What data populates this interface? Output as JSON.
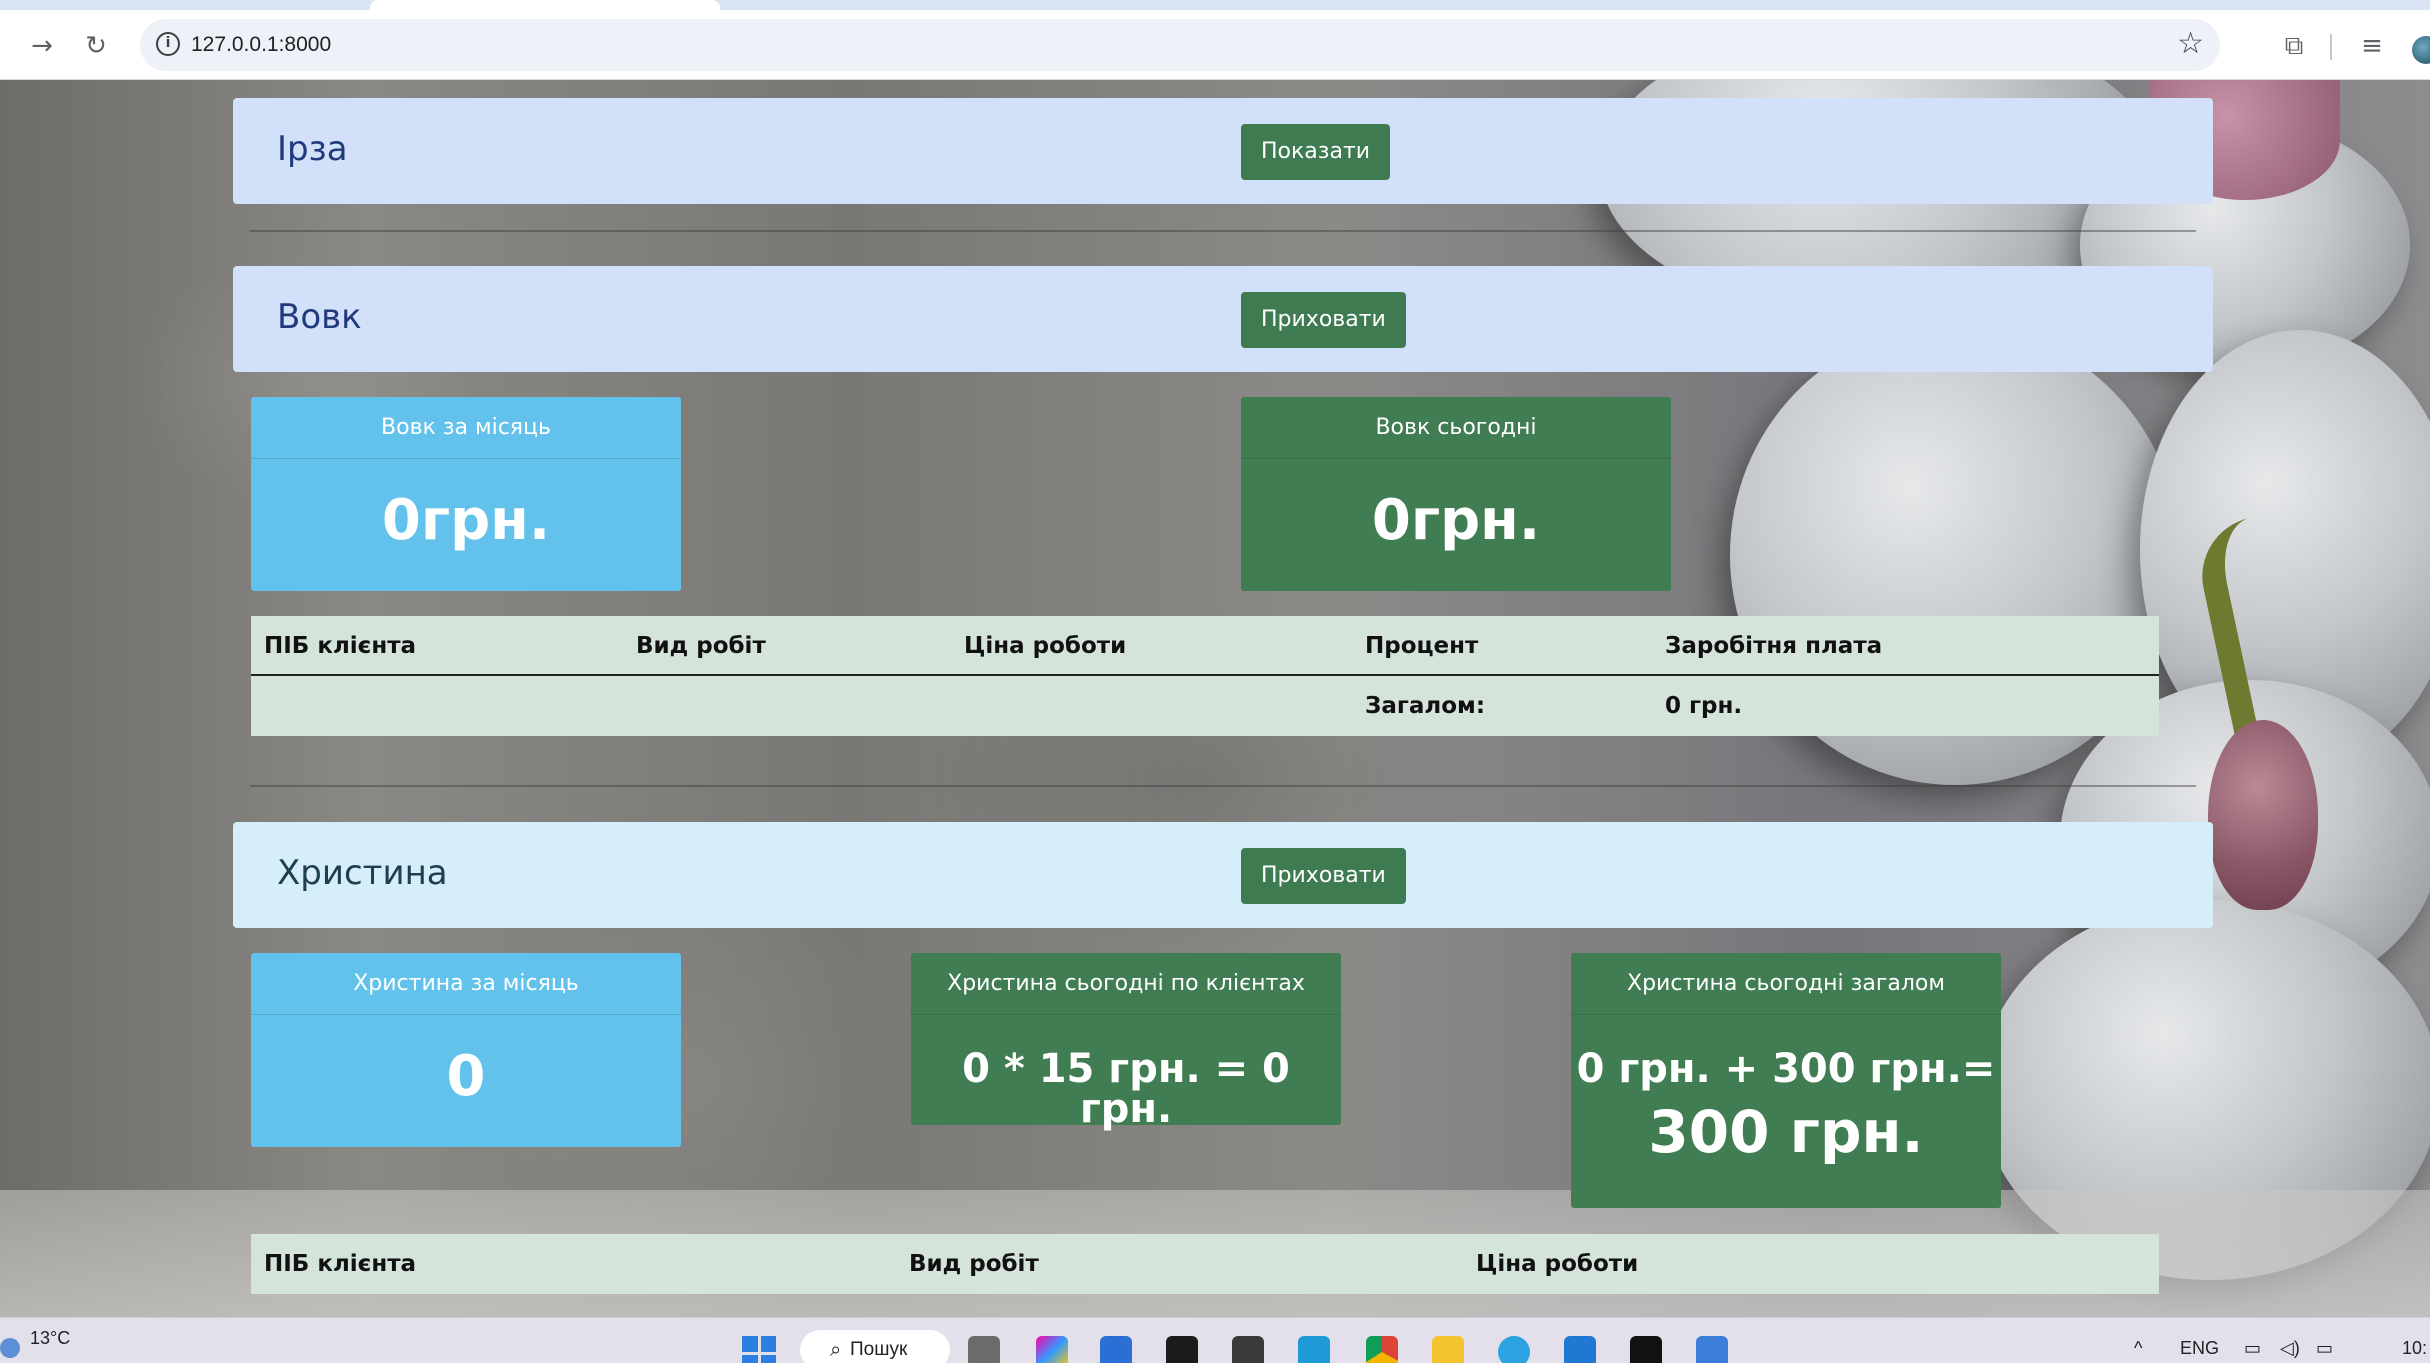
{
  "browser": {
    "url": "127.0.0.1:8000",
    "icons": [
      "back-arrow-icon",
      "reload-icon",
      "site-info-icon",
      "bookmark-star-icon",
      "extensions-icon",
      "media-controls-icon",
      "profile-avatar"
    ]
  },
  "workers": [
    {
      "name": "Ірза",
      "toggle_label": "Показати"
    },
    {
      "name": "Вовк",
      "toggle_label": "Приховати",
      "stats": {
        "month_title": "Вовк за місяць",
        "month_value": "0грн.",
        "today_title": "Вовк сьогодні",
        "today_value": "0грн."
      },
      "table": {
        "headers": [
          "ПІБ клієнта",
          "Вид робіт",
          "Ціна роботи",
          "Процент",
          "Заробітня плата"
        ],
        "total_label": "Загалом:",
        "total_value": "0 грн."
      }
    },
    {
      "name": "Христина",
      "toggle_label": "Приховати",
      "stats": {
        "month_title": "Христина за місяць",
        "month_value": "0",
        "clients_title": "Христина сьогодні по клієнтах",
        "clients_value": "0 * 15 грн. = 0 грн.",
        "total_title": "Христина сьогодні загалом",
        "total_line1": "0 грн. + 300 грн.=",
        "total_line2": "300 грн."
      },
      "table": {
        "headers": [
          "ПІБ клієнта",
          "Вид робіт",
          "Ціна роботи"
        ]
      }
    }
  ],
  "taskbar": {
    "weather_temp": "13°C",
    "search_label": "Пошук",
    "lang": "ENG",
    "clock": "10:"
  },
  "colors": {
    "header_blue": "#d3e0fa",
    "header_cyan": "#d6eefa",
    "button_green": "#3e7b51",
    "stat_blue": "#63c2ec",
    "stat_green": "#417d52",
    "table_bg": "#d5e4da"
  }
}
